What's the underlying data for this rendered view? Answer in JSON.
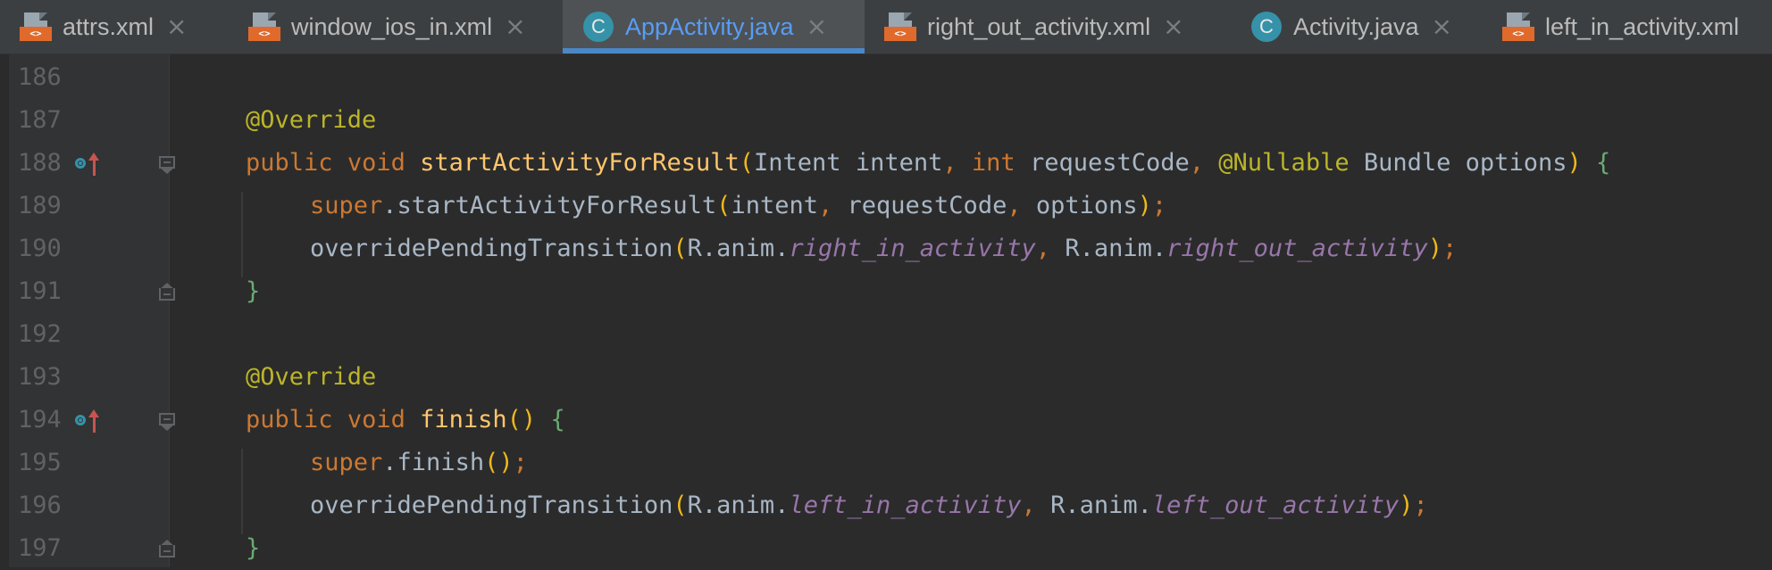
{
  "tabs": [
    {
      "label": "attrs.xml",
      "icon": "xml-file-icon",
      "active": false
    },
    {
      "label": "window_ios_in.xml",
      "icon": "xml-file-icon",
      "active": false
    },
    {
      "label": "AppActivity.java",
      "icon": "java-class-icon",
      "active": true
    },
    {
      "label": "right_out_activity.xml",
      "icon": "xml-file-icon",
      "active": false
    },
    {
      "label": "Activity.java",
      "icon": "java-class-icon",
      "active": false
    },
    {
      "label": "left_in_activity.xml",
      "icon": "xml-file-icon",
      "active": false
    }
  ],
  "icons": {
    "xml_badge": "<>",
    "class_letter": "C",
    "close": "×"
  },
  "line_numbers": [
    "186",
    "187",
    "188",
    "189",
    "190",
    "191",
    "192",
    "193",
    "194",
    "195",
    "196",
    "197"
  ],
  "code": {
    "l187": {
      "ann": "@Override"
    },
    "l188": {
      "kw1": "public",
      "kw2": "void",
      "fn": "startActivityForResult",
      "lp": "(",
      "t1": "Intent",
      "p1": "intent",
      "c1": ",",
      "kw3": "int",
      "p2": "requestCode",
      "c2": ",",
      "ann": "@Nullable",
      "t2": "Bundle",
      "p3": "options",
      "rp": ")",
      "brace": "{"
    },
    "l189": {
      "kw": "super",
      "dot": ".",
      "fn": "startActivityForResult",
      "lp": "(",
      "a1": "intent",
      "c1": ",",
      "a2": "requestCode",
      "c2": ",",
      "a3": "options",
      "rp": ")",
      "semi": ";"
    },
    "l190": {
      "fn": "overridePendingTransition",
      "lp": "(",
      "q1": "R.anim.",
      "f1": "right_in_activity",
      "c1": ",",
      "q2": "R.anim.",
      "f2": "right_out_activity",
      "rp": ")",
      "semi": ";"
    },
    "l191": {
      "brace": "}"
    },
    "l193": {
      "ann": "@Override"
    },
    "l194": {
      "kw1": "public",
      "kw2": "void",
      "fn": "finish",
      "parens": "()",
      "brace": "{"
    },
    "l195": {
      "kw": "super",
      "dot": ".",
      "fn": "finish",
      "parens": "()",
      "semi": ";"
    },
    "l196": {
      "fn": "overridePendingTransition",
      "lp": "(",
      "q1": "R.anim.",
      "f1": "left_in_activity",
      "c1": ",",
      "q2": "R.anim.",
      "f2": "left_out_activity",
      "rp": ")",
      "semi": ";"
    },
    "l197": {
      "brace": "}"
    }
  },
  "colors": {
    "background": "#2b2b2b",
    "keyword": "#cc7832",
    "annotation": "#bbb529",
    "method": "#ffc66d",
    "field": "#9876aa",
    "active_tab": "#589df6"
  }
}
